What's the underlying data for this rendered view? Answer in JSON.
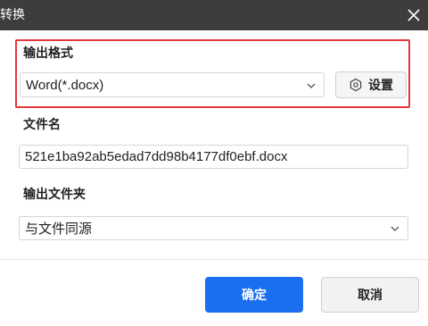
{
  "window": {
    "title": "转换"
  },
  "output_format": {
    "label": "输出格式",
    "selected": "Word(*.docx)",
    "settings_label": "设置"
  },
  "file_name": {
    "label": "文件名",
    "value": "521e1ba92ab5edad7dd98b4177df0ebf.docx"
  },
  "output_folder": {
    "label": "输出文件夹",
    "selected": "与文件同源"
  },
  "footer": {
    "confirm_label": "确定",
    "cancel_label": "取消"
  },
  "colors": {
    "titlebar": "#3d3d3d",
    "highlight": "#e5373a",
    "primary": "#1a6ff0"
  },
  "icons": {
    "close": "close-icon",
    "chevron": "chevron-down-icon",
    "settings": "hexagon-gear-icon"
  }
}
